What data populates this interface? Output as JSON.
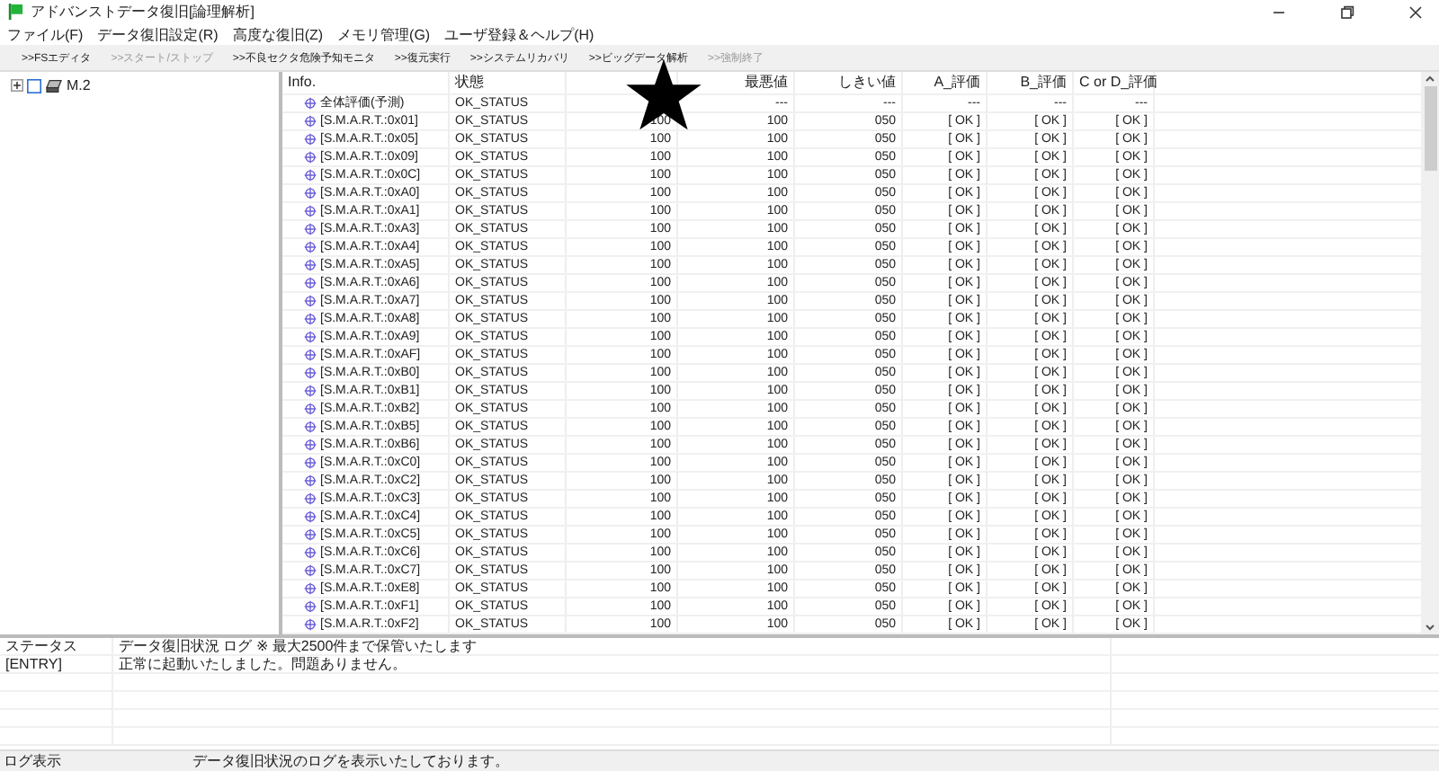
{
  "window": {
    "title": "アドバンストデータ復旧[論理解析]"
  },
  "menu": [
    "ファイル(F)",
    "データ復旧設定(R)",
    "高度な復旧(Z)",
    "メモリ管理(G)",
    "ユーザ登録＆ヘルプ(H)"
  ],
  "toolbar": [
    {
      "label": ">>FSエディタ",
      "disabled": false
    },
    {
      "label": ">>スタート/ストップ",
      "disabled": true
    },
    {
      "label": ">>不良セクタ危険予知モニタ",
      "disabled": false
    },
    {
      "label": ">>復元実行",
      "disabled": false
    },
    {
      "label": ">>システムリカバリ",
      "disabled": false
    },
    {
      "label": ">>ビッグデータ解析",
      "disabled": false
    },
    {
      "label": ">>強制終了",
      "disabled": true
    }
  ],
  "tree": [
    {
      "label": "M.2",
      "expanded": false,
      "checked": false
    }
  ],
  "table": {
    "columns": [
      {
        "label": "Info."
      },
      {
        "label": "状態"
      },
      {},
      {
        "label": "最悪値"
      },
      {
        "label": "しきい値"
      },
      {
        "label": "A_評価"
      },
      {
        "label": "B_評価"
      },
      {
        "label": "C or D_評価"
      }
    ],
    "rows": [
      {
        "cells": [
          "全体評価(予測)",
          "OK_STATUS",
          null,
          "---",
          "---",
          "---",
          "---",
          "---"
        ]
      },
      {
        "cells": [
          "[S.M.A.R.T.:0x01]",
          "OK_STATUS",
          "100",
          "100",
          "050",
          "[ OK ]",
          "[ OK ]",
          "[ OK ]"
        ]
      },
      {
        "cells": [
          "[S.M.A.R.T.:0x05]",
          "OK_STATUS",
          "100",
          "100",
          "050",
          "[ OK ]",
          "[ OK ]",
          "[ OK ]"
        ]
      },
      {
        "cells": [
          "[S.M.A.R.T.:0x09]",
          "OK_STATUS",
          "100",
          "100",
          "050",
          "[ OK ]",
          "[ OK ]",
          "[ OK ]"
        ]
      },
      {
        "cells": [
          "[S.M.A.R.T.:0x0C]",
          "OK_STATUS",
          "100",
          "100",
          "050",
          "[ OK ]",
          "[ OK ]",
          "[ OK ]"
        ]
      },
      {
        "cells": [
          "[S.M.A.R.T.:0xA0]",
          "OK_STATUS",
          "100",
          "100",
          "050",
          "[ OK ]",
          "[ OK ]",
          "[ OK ]"
        ]
      },
      {
        "cells": [
          "[S.M.A.R.T.:0xA1]",
          "OK_STATUS",
          "100",
          "100",
          "050",
          "[ OK ]",
          "[ OK ]",
          "[ OK ]"
        ]
      },
      {
        "cells": [
          "[S.M.A.R.T.:0xA3]",
          "OK_STATUS",
          "100",
          "100",
          "050",
          "[ OK ]",
          "[ OK ]",
          "[ OK ]"
        ]
      },
      {
        "cells": [
          "[S.M.A.R.T.:0xA4]",
          "OK_STATUS",
          "100",
          "100",
          "050",
          "[ OK ]",
          "[ OK ]",
          "[ OK ]"
        ]
      },
      {
        "cells": [
          "[S.M.A.R.T.:0xA5]",
          "OK_STATUS",
          "100",
          "100",
          "050",
          "[ OK ]",
          "[ OK ]",
          "[ OK ]"
        ]
      },
      {
        "cells": [
          "[S.M.A.R.T.:0xA6]",
          "OK_STATUS",
          "100",
          "100",
          "050",
          "[ OK ]",
          "[ OK ]",
          "[ OK ]"
        ]
      },
      {
        "cells": [
          "[S.M.A.R.T.:0xA7]",
          "OK_STATUS",
          "100",
          "100",
          "050",
          "[ OK ]",
          "[ OK ]",
          "[ OK ]"
        ]
      },
      {
        "cells": [
          "[S.M.A.R.T.:0xA8]",
          "OK_STATUS",
          "100",
          "100",
          "050",
          "[ OK ]",
          "[ OK ]",
          "[ OK ]"
        ]
      },
      {
        "cells": [
          "[S.M.A.R.T.:0xA9]",
          "OK_STATUS",
          "100",
          "100",
          "050",
          "[ OK ]",
          "[ OK ]",
          "[ OK ]"
        ]
      },
      {
        "cells": [
          "[S.M.A.R.T.:0xAF]",
          "OK_STATUS",
          "100",
          "100",
          "050",
          "[ OK ]",
          "[ OK ]",
          "[ OK ]"
        ]
      },
      {
        "cells": [
          "[S.M.A.R.T.:0xB0]",
          "OK_STATUS",
          "100",
          "100",
          "050",
          "[ OK ]",
          "[ OK ]",
          "[ OK ]"
        ]
      },
      {
        "cells": [
          "[S.M.A.R.T.:0xB1]",
          "OK_STATUS",
          "100",
          "100",
          "050",
          "[ OK ]",
          "[ OK ]",
          "[ OK ]"
        ]
      },
      {
        "cells": [
          "[S.M.A.R.T.:0xB2]",
          "OK_STATUS",
          "100",
          "100",
          "050",
          "[ OK ]",
          "[ OK ]",
          "[ OK ]"
        ]
      },
      {
        "cells": [
          "[S.M.A.R.T.:0xB5]",
          "OK_STATUS",
          "100",
          "100",
          "050",
          "[ OK ]",
          "[ OK ]",
          "[ OK ]"
        ]
      },
      {
        "cells": [
          "[S.M.A.R.T.:0xB6]",
          "OK_STATUS",
          "100",
          "100",
          "050",
          "[ OK ]",
          "[ OK ]",
          "[ OK ]"
        ]
      },
      {
        "cells": [
          "[S.M.A.R.T.:0xC0]",
          "OK_STATUS",
          "100",
          "100",
          "050",
          "[ OK ]",
          "[ OK ]",
          "[ OK ]"
        ]
      },
      {
        "cells": [
          "[S.M.A.R.T.:0xC2]",
          "OK_STATUS",
          "100",
          "100",
          "050",
          "[ OK ]",
          "[ OK ]",
          "[ OK ]"
        ]
      },
      {
        "cells": [
          "[S.M.A.R.T.:0xC3]",
          "OK_STATUS",
          "100",
          "100",
          "050",
          "[ OK ]",
          "[ OK ]",
          "[ OK ]"
        ]
      },
      {
        "cells": [
          "[S.M.A.R.T.:0xC4]",
          "OK_STATUS",
          "100",
          "100",
          "050",
          "[ OK ]",
          "[ OK ]",
          "[ OK ]"
        ]
      },
      {
        "cells": [
          "[S.M.A.R.T.:0xC5]",
          "OK_STATUS",
          "100",
          "100",
          "050",
          "[ OK ]",
          "[ OK ]",
          "[ OK ]"
        ]
      },
      {
        "cells": [
          "[S.M.A.R.T.:0xC6]",
          "OK_STATUS",
          "100",
          "100",
          "050",
          "[ OK ]",
          "[ OK ]",
          "[ OK ]"
        ]
      },
      {
        "cells": [
          "[S.M.A.R.T.:0xC7]",
          "OK_STATUS",
          "100",
          "100",
          "050",
          "[ OK ]",
          "[ OK ]",
          "[ OK ]"
        ]
      },
      {
        "cells": [
          "[S.M.A.R.T.:0xE8]",
          "OK_STATUS",
          "100",
          "100",
          "050",
          "[ OK ]",
          "[ OK ]",
          "[ OK ]"
        ]
      },
      {
        "cells": [
          "[S.M.A.R.T.:0xF1]",
          "OK_STATUS",
          "100",
          "100",
          "050",
          "[ OK ]",
          "[ OK ]",
          "[ OK ]"
        ]
      },
      {
        "cells": [
          "[S.M.A.R.T.:0xF2]",
          "OK_STATUS",
          "100",
          "100",
          "050",
          "[ OK ]",
          "[ OK ]",
          "[ OK ]"
        ]
      }
    ]
  },
  "log": {
    "columns": [
      "ステータス",
      "データ復旧状況 ログ ※ 最大2500件まで保管いたします"
    ],
    "rows": [
      {
        "type": "[ENTRY]",
        "message": "正常に起動いたしました。問題ありません。"
      }
    ]
  },
  "status_bar": [
    "ログ表示",
    "データ復旧状況のログを表示いたしております。"
  ]
}
